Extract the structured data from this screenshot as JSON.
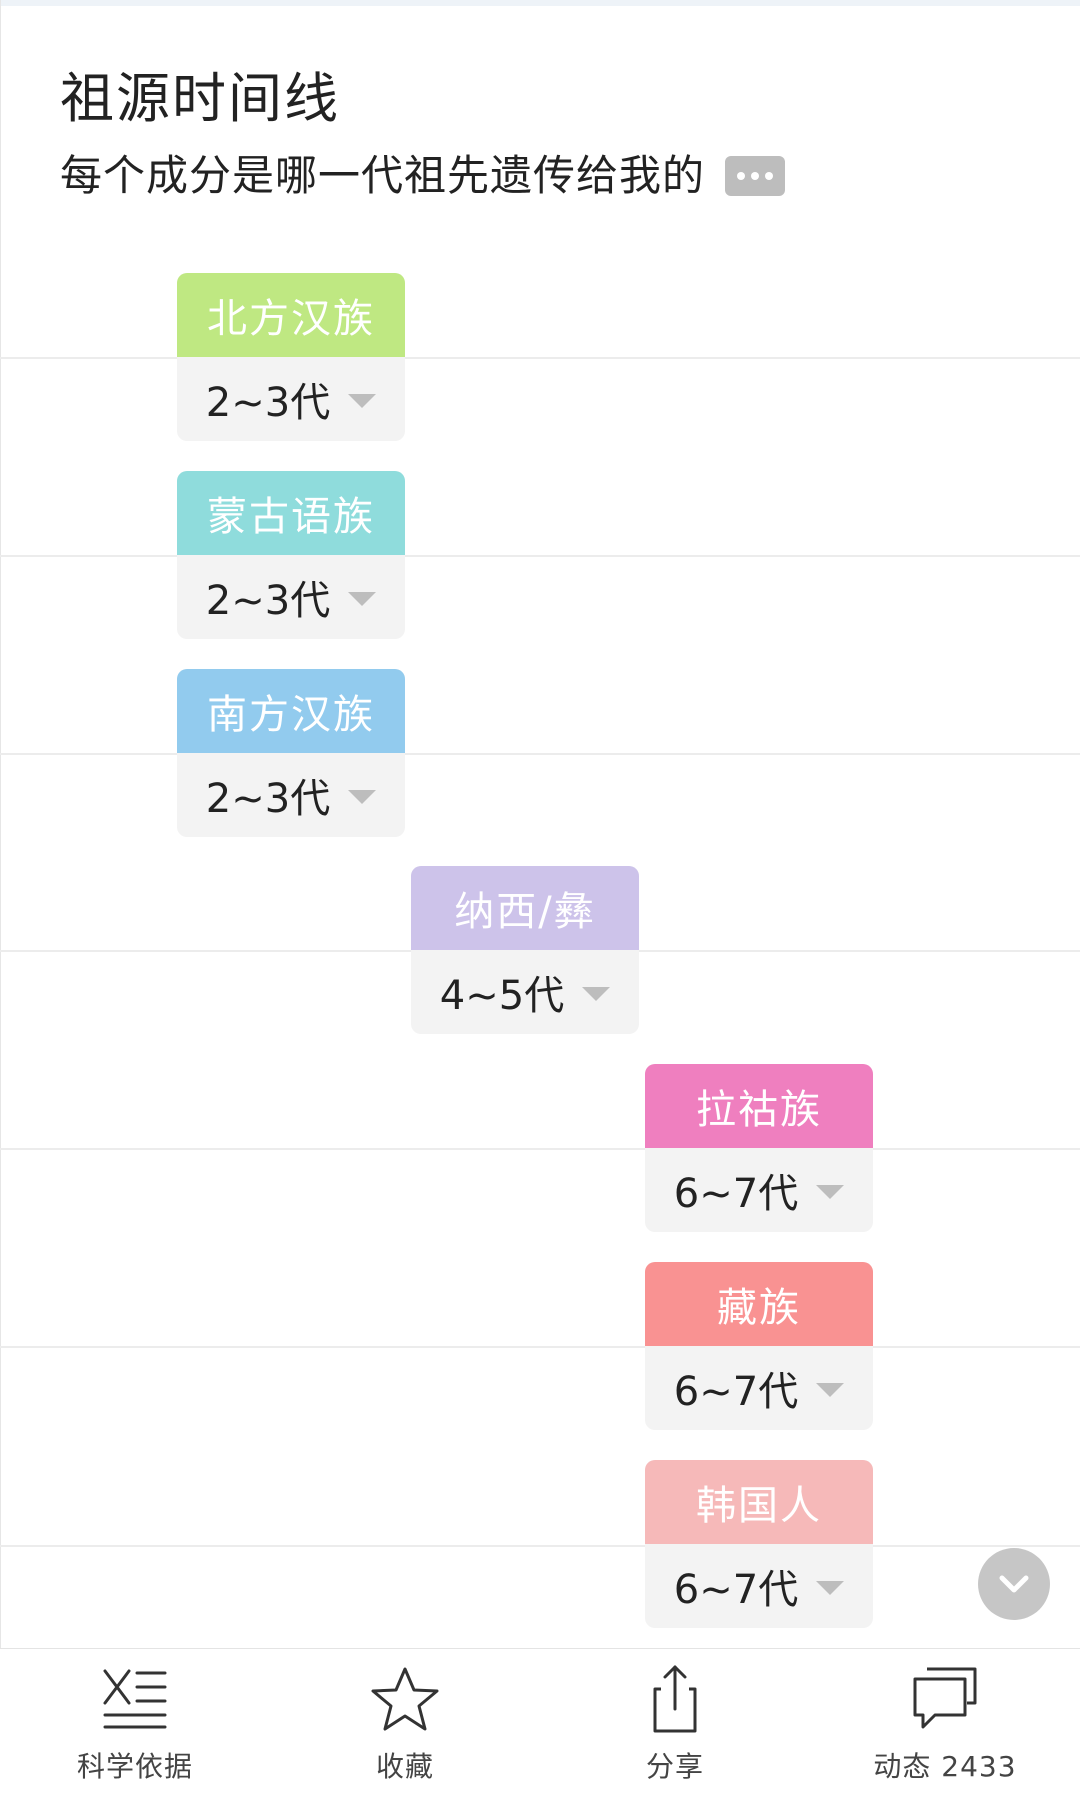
{
  "header": {
    "title": "祖源时间线",
    "subtitle": "每个成分是哪一代祖先遗传给我的"
  },
  "ancestry_items": [
    {
      "label": "北方汉族",
      "generation": "2~3代",
      "color": "#bfe882"
    },
    {
      "label": "蒙古语族",
      "generation": "2~3代",
      "color": "#8fdcdc"
    },
    {
      "label": "南方汉族",
      "generation": "2~3代",
      "color": "#92cbee"
    },
    {
      "label": "纳西/彝",
      "generation": "4~5代",
      "color": "#cdc3ea"
    },
    {
      "label": "拉祜族",
      "generation": "6~7代",
      "color": "#ef7fbf"
    },
    {
      "label": "藏族",
      "generation": "6~7代",
      "color": "#f99292"
    },
    {
      "label": "韩国人",
      "generation": "6~7代",
      "color": "#f6b9b9"
    }
  ],
  "bottom_nav": [
    {
      "label": "科学依据",
      "icon": "dna-list-icon"
    },
    {
      "label": "收藏",
      "icon": "star-icon"
    },
    {
      "label": "分享",
      "icon": "share-icon"
    },
    {
      "label": "动态 2433",
      "icon": "chat-bubbles-icon"
    }
  ]
}
